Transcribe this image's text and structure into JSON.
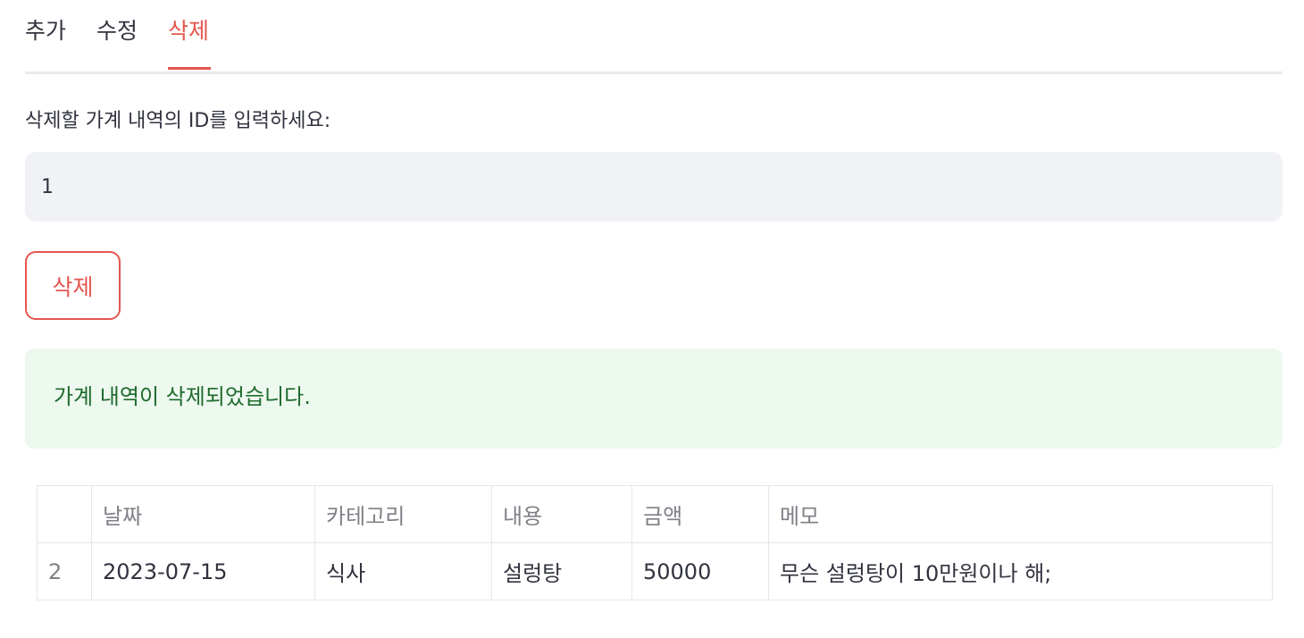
{
  "tabs": [
    {
      "label": "추가",
      "active": false
    },
    {
      "label": "수정",
      "active": false
    },
    {
      "label": "삭제",
      "active": true
    }
  ],
  "form": {
    "id_label": "삭제할 가계 내역의 ID를 입력하세요:",
    "id_value": "1",
    "delete_button_label": "삭제"
  },
  "alert": {
    "type": "success",
    "message": "가계 내역이 삭제되었습니다."
  },
  "table": {
    "columns": [
      "",
      "날짜",
      "카테고리",
      "내용",
      "금액",
      "메모"
    ],
    "rows": [
      {
        "index": "2",
        "date": "2023-07-15",
        "category": "식사",
        "content": "설렁탕",
        "amount": "50000",
        "memo": "무슨 설렁탕이 10만원이나 해;"
      }
    ]
  },
  "colors": {
    "accent": "#e4564e",
    "success_bg": "#edf8ef",
    "success_text": "#1f6b2d",
    "input_bg": "#f0f2f6"
  }
}
